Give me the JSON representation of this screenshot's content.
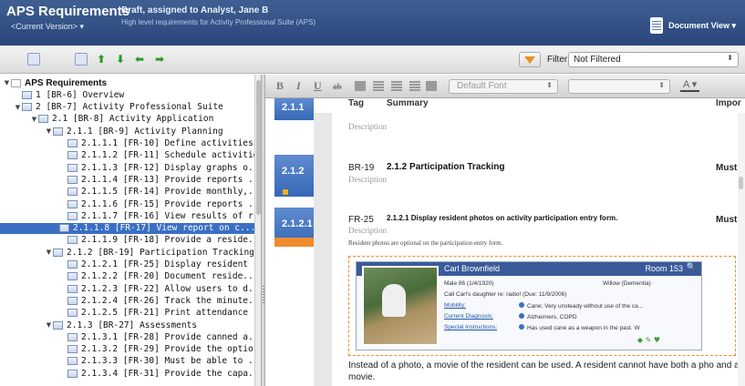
{
  "header": {
    "title": "APS Requirements",
    "version": "<Current Version> ▾",
    "status": "Draft, assigned to Analyst, Jane B",
    "description": "High level requirements for Activity Professional Suite (APS)",
    "view_label": "Document View ▾"
  },
  "toolbar": {
    "filter_label": "Filter:",
    "filter_value": "Not Filtered",
    "icons": [
      "document-icon",
      "document-icon",
      "arrow-up-icon",
      "arrow-down-icon",
      "arrow-left-icon",
      "arrow-right-icon"
    ]
  },
  "tree": {
    "items": [
      {
        "text": "APS Requirements",
        "level": 0,
        "twisty": "▼",
        "bold": true
      },
      {
        "text": "1 [BR-6] Overview",
        "level": 1,
        "twisty": ""
      },
      {
        "text": "2 [BR-7] Activity Professional Suite",
        "level": 1,
        "twisty": "▼"
      },
      {
        "text": "2.1 [BR-8] Activity Application",
        "level": 2,
        "twisty": "▼"
      },
      {
        "text": "2.1.1 [BR-9] Activity Planning",
        "level": 3,
        "twisty": "▼"
      },
      {
        "text": "2.1.1.1 [FR-10] Define activities.",
        "level": 4,
        "twisty": ""
      },
      {
        "text": "2.1.1.2 [FR-11] Schedule activities.",
        "level": 4,
        "twisty": ""
      },
      {
        "text": "2.1.1.3 [FR-12] Display graphs o...",
        "level": 4,
        "twisty": ""
      },
      {
        "text": "2.1.1.4 [FR-13] Provide reports ...",
        "level": 4,
        "twisty": ""
      },
      {
        "text": "2.1.1.5 [FR-14] Provide monthly,...",
        "level": 4,
        "twisty": ""
      },
      {
        "text": "2.1.1.6 [FR-15] Provide reports ...",
        "level": 4,
        "twisty": ""
      },
      {
        "text": "2.1.1.7 [FR-16] View results of r...",
        "level": 4,
        "twisty": ""
      },
      {
        "text": "2.1.1.8 [FR-17] View report on c...",
        "level": 4,
        "twisty": "",
        "selected": true
      },
      {
        "text": "2.1.1.9 [FR-18] Provide a reside...",
        "level": 4,
        "twisty": ""
      },
      {
        "text": "2.1.2 [BR-19] Participation Tracking",
        "level": 3,
        "twisty": "▼"
      },
      {
        "text": "2.1.2.1 [FR-25] Display resident ...",
        "level": 4,
        "twisty": ""
      },
      {
        "text": "2.1.2.2 [FR-20] Document reside...",
        "level": 4,
        "twisty": ""
      },
      {
        "text": "2.1.2.3 [FR-22] Allow users to d...",
        "level": 4,
        "twisty": ""
      },
      {
        "text": "2.1.2.4 [FR-26] Track the minute...",
        "level": 4,
        "twisty": ""
      },
      {
        "text": "2.1.2.5 [FR-21] Print attendance ...",
        "level": 4,
        "twisty": ""
      },
      {
        "text": "2.1.3 [BR-27] Assessments",
        "level": 3,
        "twisty": "▼"
      },
      {
        "text": "2.1.3.1 [FR-28] Provide canned a...",
        "level": 4,
        "twisty": ""
      },
      {
        "text": "2.1.3.2 [FR-29] Provide the optio...",
        "level": 4,
        "twisty": ""
      },
      {
        "text": "2.1.3.3 [FR-30] Must be able to ...",
        "level": 4,
        "twisty": ""
      },
      {
        "text": "2.1.3.4 [FR-31] Provide the capa...",
        "level": 4,
        "twisty": ""
      }
    ]
  },
  "editor": {
    "bold": "B",
    "italic": "I",
    "underline": "U",
    "strike": "ab",
    "font": "Default Font",
    "color": "A ▾"
  },
  "columns": {
    "tag": "Tag",
    "summary": "Summary",
    "importance": "Impor"
  },
  "requirements": [
    {
      "tab": "2.1.1",
      "tag": "",
      "title": "",
      "desc": "Description",
      "importance": ""
    },
    {
      "tab": "2.1.2",
      "tag": "BR-19",
      "title": "2.1.2 Participation Tracking",
      "desc": "Description",
      "importance": "Must"
    },
    {
      "tab": "2.1.2.1",
      "tag": "FR-25",
      "title": "2.1.2.1 Display resident photos on activity participation entry form.",
      "desc": "Description",
      "importance": "Must",
      "body": "Resident photos are optional on the participation entry form."
    }
  ],
  "card": {
    "name": "Carl Brownfield",
    "room": "Room 153",
    "dob": "Male 86 (1/4/1920)",
    "status": "Willow (Dementia)",
    "call": "Call Carl's daughter re: radio! (Due: 11/9/2006)",
    "mobility_label": "Mobility:",
    "mobility": "Cane; Very unsteady without use of the ca...",
    "diagnosis_label": "Current Diagnosis:",
    "diagnosis": "Alzheimers, COPD",
    "instructions_label": "Special Instructions:",
    "instructions": "Has used cane as a weapon in the past. W"
  },
  "footer_text": "Instead of a photo, a movie of the resident can be used. A resident cannot have both a pho and a movie.",
  "colors": {
    "header": "#2f4d82",
    "tab_blue": "#3f72c0",
    "accent_orange": "#f08c30",
    "selection": "#3a6fc4"
  }
}
